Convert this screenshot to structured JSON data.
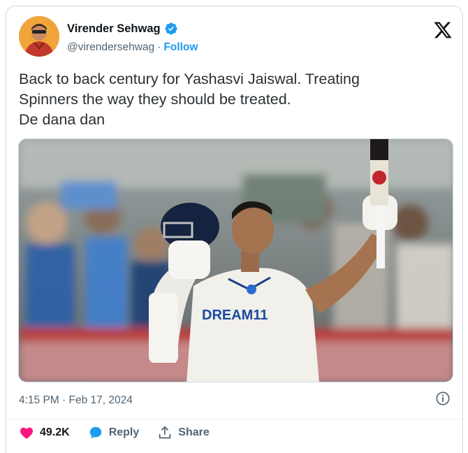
{
  "author": {
    "display_name": "Virender Sehwag",
    "handle": "@virendersehwag",
    "separator": "·",
    "follow_label": "Follow",
    "verified_icon": "verified-badge-icon"
  },
  "platform_icon": "x-logo-icon",
  "tweet": {
    "text": "Back to back century for Yashasvi Jaiswal. Treating\nSpinners the way they should be treated.\nDe dana dan"
  },
  "media": {
    "jersey_text": "DREAM11"
  },
  "meta": {
    "timestamp": "4:15 PM · Feb 17, 2024",
    "info_icon": "info-icon"
  },
  "actions": {
    "likes": "49.2K",
    "reply_label": "Reply",
    "share_label": "Share"
  },
  "colors": {
    "accent": "#1d9bf0",
    "like": "#f91880",
    "secondary_text": "#536471"
  }
}
